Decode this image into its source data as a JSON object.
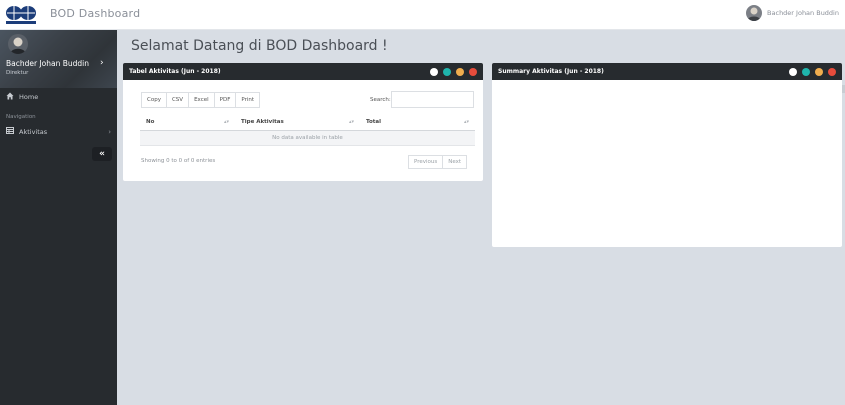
{
  "app": {
    "title": "BOD Dashboard"
  },
  "topbar": {
    "user_name": "Bachder Johan Buddin"
  },
  "sidebar": {
    "profile": {
      "name": "Bachder Johan Buddin",
      "role": "Direktur"
    },
    "home_label": "Home",
    "section_label": "Navigation",
    "items": [
      {
        "label": "Aktivitas",
        "icon": "table-icon"
      }
    ],
    "collapse_label": "«"
  },
  "main": {
    "title": "Selamat Datang di BOD Dashboard !",
    "table_panel": {
      "title": "Tabel Aktivitas (Jun - 2018)",
      "buttons": [
        "Copy",
        "CSV",
        "Excel",
        "PDF",
        "Print"
      ],
      "search_label": "Search:",
      "columns": [
        "No",
        "Tipe Aktivitas",
        "Total"
      ],
      "empty_text": "No data available in table",
      "info": "Showing 0 to 0 of 0 entries",
      "prev_label": "Previous",
      "next_label": "Next"
    },
    "summary_panel": {
      "title": "Summary Aktivitas (Jun - 2018)"
    }
  },
  "colors": {
    "header_dark": "#272b2f",
    "dot_white": "#ffffff",
    "dot_teal": "#1fb5ad",
    "dot_orange": "#f0ad4e",
    "dot_red": "#e74c3c"
  }
}
